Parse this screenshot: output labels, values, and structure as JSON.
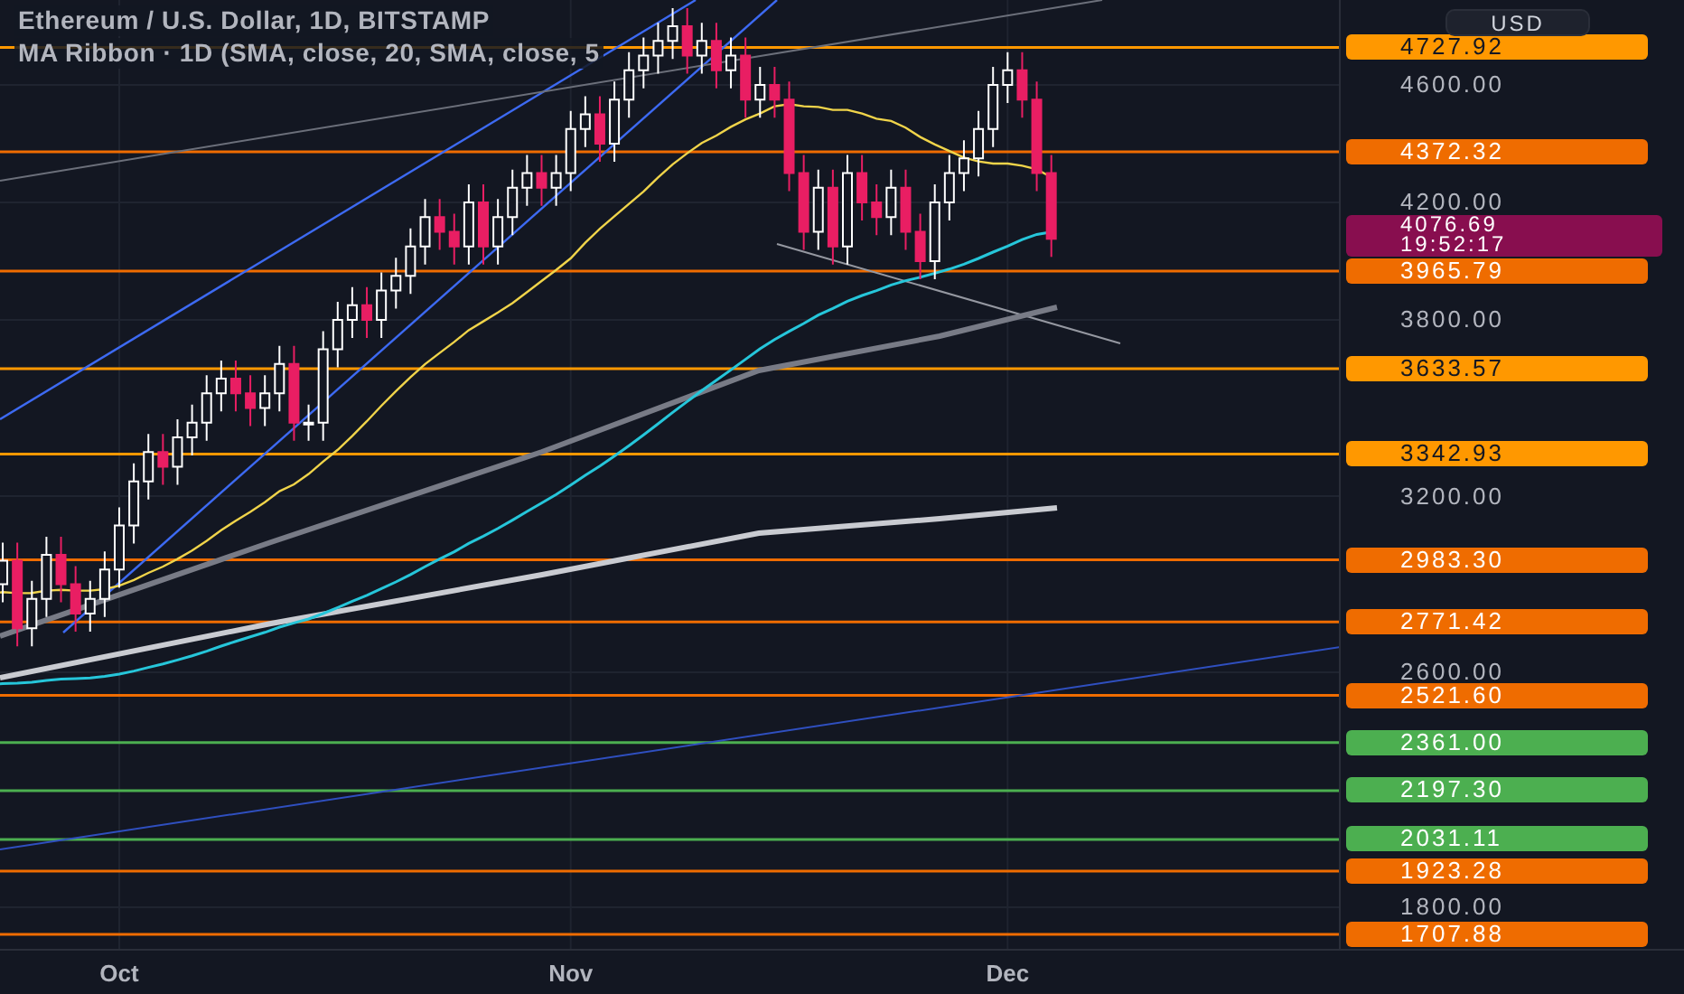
{
  "legend": {
    "symbol": "Ethereum / U.S. Dollar, 1D, BITSTAMP",
    "indicator": "MA Ribbon · 1D (SMA, close, 20, SMA, close, 5"
  },
  "currency_button": "USD",
  "price_axis": {
    "ticks": [
      "4600.00",
      "4200.00",
      "3800.00",
      "3200.00",
      "2600.00",
      "1800.00"
    ]
  },
  "levels": [
    {
      "price": "4727.92",
      "color": "#ff9800"
    },
    {
      "price": "4372.32",
      "color": "#ef6c00"
    },
    {
      "price": "3965.79",
      "color": "#ef6c00"
    },
    {
      "price": "3633.57",
      "color": "#ff9800"
    },
    {
      "price": "3342.93",
      "color": "#ff9800"
    },
    {
      "price": "2983.30",
      "color": "#ef6c00"
    },
    {
      "price": "2771.42",
      "color": "#ef6c00"
    },
    {
      "price": "2521.60",
      "color": "#ef6c00"
    },
    {
      "price": "2361.00",
      "color": "#4caf50"
    },
    {
      "price": "2197.30",
      "color": "#4caf50"
    },
    {
      "price": "2031.11",
      "color": "#4caf50"
    },
    {
      "price": "1923.28",
      "color": "#ef6c00"
    },
    {
      "price": "1707.88",
      "color": "#ef6c00"
    }
  ],
  "last_price": {
    "price": "4076.69",
    "countdown": "19:52:17"
  },
  "time_axis": {
    "labels": [
      "Oct",
      "Nov",
      "Dec"
    ]
  }
}
